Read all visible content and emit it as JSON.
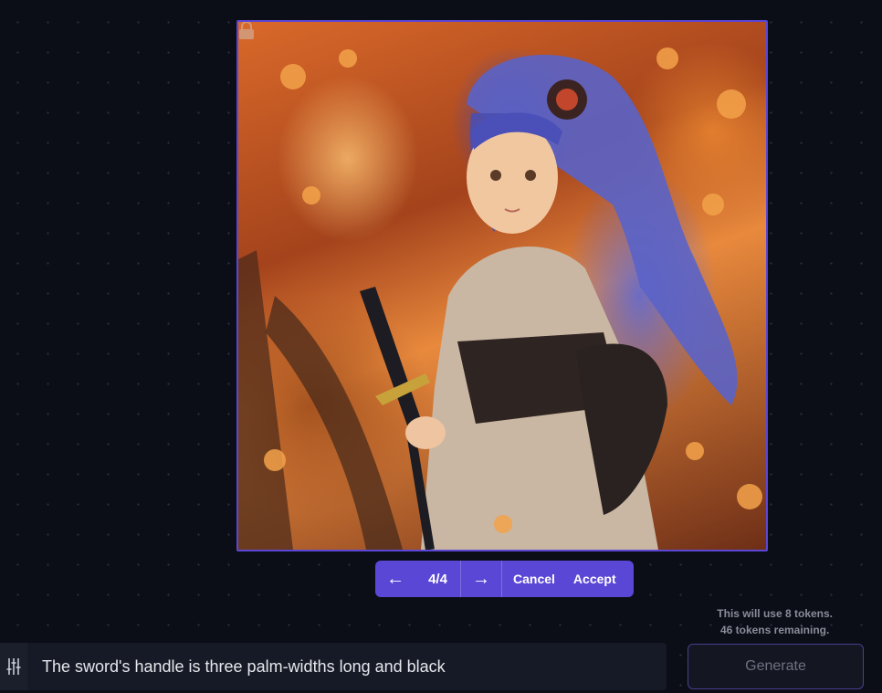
{
  "canvas": {
    "image_description_icon": "generated-image",
    "lock_icon": "lock-icon"
  },
  "pager": {
    "prev_icon": "←",
    "count": "4/4",
    "next_icon": "→",
    "cancel_label": "Cancel",
    "accept_label": "Accept"
  },
  "tokens": {
    "usage": "This will use 8 tokens.",
    "remaining": "46 tokens remaining."
  },
  "prompt": {
    "value": "The sword's handle is three palm-widths long and black"
  },
  "generate": {
    "label": "Generate"
  },
  "colors": {
    "accent": "#5a47d5",
    "background": "#0b0d17",
    "frame": "#5b46d6"
  }
}
